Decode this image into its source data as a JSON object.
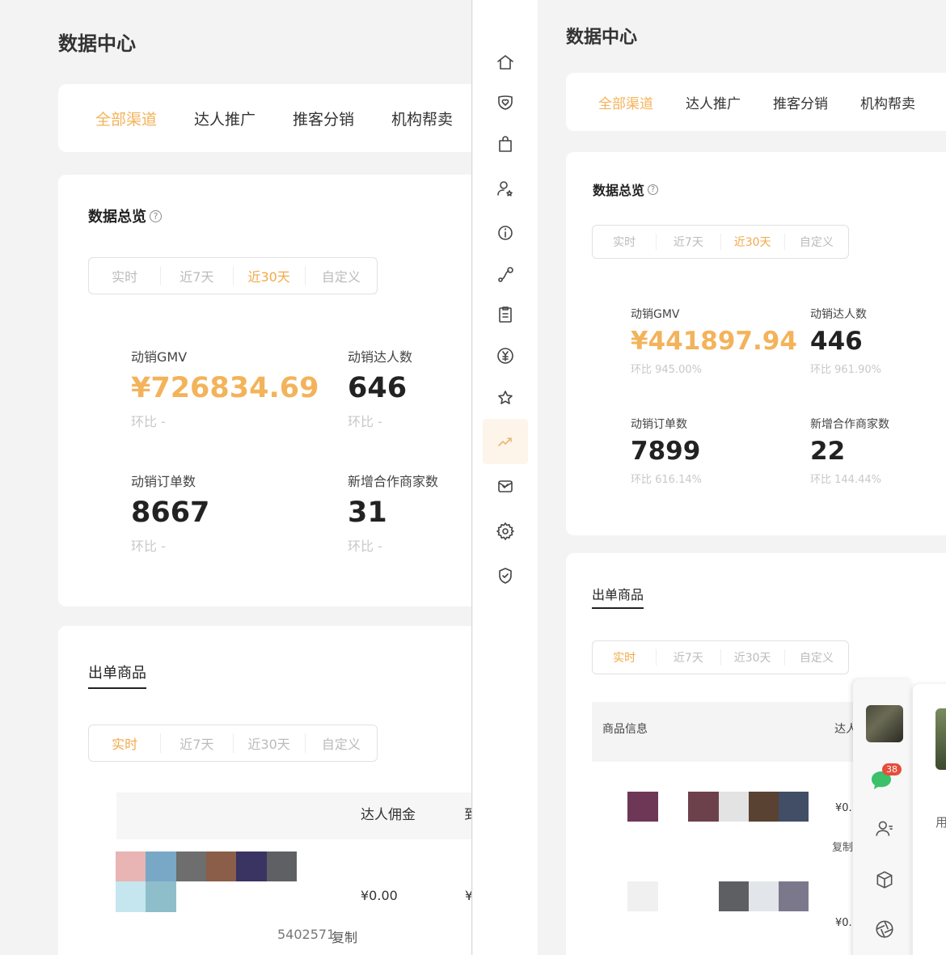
{
  "left": {
    "title": "数据中心",
    "tabs": [
      "全部渠道",
      "达人推广",
      "推客分销",
      "机构帮卖"
    ],
    "overview": {
      "title": "数据总览",
      "help": "?",
      "periods": [
        "实时",
        "近7天",
        "近30天",
        "自定义"
      ],
      "metrics": [
        {
          "label": "动销GMV",
          "value": "¥726834.69",
          "compare": "环比 -"
        },
        {
          "label": "动销达人数",
          "value": "646",
          "compare": "环比 -"
        },
        {
          "label": "动销订单数",
          "value": "8667",
          "compare": "环比 -"
        },
        {
          "label": "新增合作商家数",
          "value": "31",
          "compare": "环比 -"
        }
      ]
    },
    "products": {
      "title": "出单商品",
      "periods": [
        "实时",
        "近7天",
        "近30天",
        "自定义"
      ],
      "col_commission": "达人佣金",
      "col_truncated": "到",
      "price": "¥0.00",
      "price_truncated": "¥",
      "id_partial": "5402571",
      "copy": "复制"
    }
  },
  "right": {
    "title": "数据中心",
    "tabs": [
      "全部渠道",
      "达人推广",
      "推客分销",
      "机构帮卖"
    ],
    "overview": {
      "title": "数据总览",
      "help": "?",
      "periods": [
        "实时",
        "近7天",
        "近30天",
        "自定义"
      ],
      "metrics": [
        {
          "label": "动销GMV",
          "value": "¥441897.94",
          "compare": "环比 945.00%"
        },
        {
          "label": "动销达人数",
          "value": "446",
          "compare": "环比 961.90%"
        },
        {
          "label": "动销订单数",
          "value": "7899",
          "compare": "环比 616.14%"
        },
        {
          "label": "新增合作商家数",
          "value": "22",
          "compare": "环比 144.44%"
        }
      ]
    },
    "products": {
      "title": "出单商品",
      "periods": [
        "实时",
        "近7天",
        "近30天",
        "自定义"
      ],
      "col_info": "商品信息",
      "col_partial": "达人",
      "price1": "¥0.",
      "copy": "复制",
      "price2": "¥0."
    },
    "popup": {
      "badge": "38",
      "side_char": "用"
    }
  },
  "sidebar_icons": [
    "home-icon",
    "heart-shield-icon",
    "bag-icon",
    "user-star-icon",
    "info-circle-icon",
    "nodes-icon",
    "clipboard-icon",
    "yuan-icon",
    "star-icon",
    "trend-chart-icon",
    "mail-check-icon",
    "gear-icon",
    "shield-check-icon"
  ],
  "colors": {
    "accent": "#f3b35a",
    "active_bg": "#fdf5ea",
    "badge": "#e74c3c",
    "chat": "#3cc06a"
  }
}
